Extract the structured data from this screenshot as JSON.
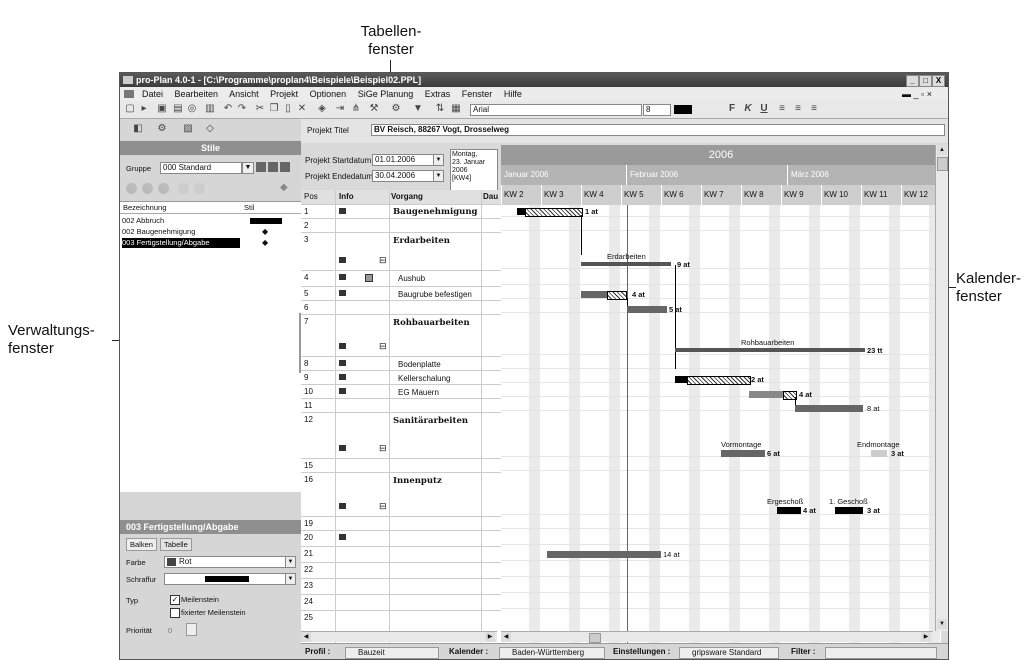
{
  "callouts": {
    "tabellen": "Tabellen-\nfenster",
    "kalender": "Kalender-\nfenster",
    "verwaltung": "Verwaltungs-\nfenster"
  },
  "window": {
    "title": "pro-Plan 4.0-1 - [C:\\Programme\\proplan4\\Beispiele\\Beispiel02.PPL]",
    "minimize": "_",
    "maximize": "□",
    "close": "X"
  },
  "menu": [
    "Datei",
    "Bearbeiten",
    "Ansicht",
    "Projekt",
    "Optionen",
    "SiGe Planung",
    "Extras",
    "Fenster",
    "Hilfe"
  ],
  "toolbar": {
    "font": "Arial",
    "font_size": "8",
    "bold": "F",
    "italic": "K",
    "underline": "U"
  },
  "left": {
    "styles_header": "Stile",
    "group_label": "Gruppe",
    "group_value": "000 Standard",
    "col_name": "Bezeichnung",
    "col_style": "Stil",
    "styles": [
      "002 Abbruch",
      "002 Baugenehmigung",
      "003 Fertigstellung/Abgabe"
    ],
    "detail_header": "003 Fertigstellung/Abgabe",
    "tabs": [
      "Balken",
      "Tabelle"
    ],
    "farbe_label": "Farbe",
    "farbe_value": "Rot",
    "schraffur_label": "Schraffur",
    "typ_label": "Typ",
    "meilenstein": "Meilenstein",
    "fix_meilenstein": "fixierter Meilenstein",
    "prio_label": "Priorität",
    "prio_value": "0"
  },
  "project": {
    "title_label": "Projekt Titel",
    "title_value": "BV Reisch, 88267 Vogt, Drosselweg",
    "start_label": "Projekt Startdatum",
    "start_value": "01.01.2006",
    "end_label": "Projekt Endedatum",
    "end_value": "30.04.2006",
    "today": "Montag,\n23. Januar\n2006\n[KW4]"
  },
  "table": {
    "col_pos": "Pos",
    "col_info": "Info",
    "col_vorgang": "Vorgang",
    "col_dau": "Dau",
    "rows": [
      {
        "pos": "1",
        "name": "Baugenehmigung",
        "bold": true
      },
      {
        "pos": "2",
        "name": ""
      },
      {
        "pos": "3",
        "name": "Erdarbeiten",
        "bold": true
      },
      {
        "pos": "4",
        "name": "Aushub"
      },
      {
        "pos": "5",
        "name": "Baugrube befestigen"
      },
      {
        "pos": "6",
        "name": ""
      },
      {
        "pos": "7",
        "name": "Rohbauarbeiten",
        "bold": true
      },
      {
        "pos": "8",
        "name": "Bodenplatte"
      },
      {
        "pos": "9",
        "name": "Kellerschalung"
      },
      {
        "pos": "10",
        "name": "EG Mauern"
      },
      {
        "pos": "11",
        "name": ""
      },
      {
        "pos": "12",
        "name": "Sanitärarbeiten",
        "bold": true
      },
      {
        "pos": "15",
        "name": ""
      },
      {
        "pos": "16",
        "name": "Innenputz",
        "bold": true
      },
      {
        "pos": "19",
        "name": ""
      },
      {
        "pos": "20",
        "name": ""
      },
      {
        "pos": "21",
        "name": ""
      },
      {
        "pos": "22",
        "name": ""
      },
      {
        "pos": "23",
        "name": ""
      },
      {
        "pos": "24",
        "name": ""
      },
      {
        "pos": "25",
        "name": ""
      }
    ]
  },
  "calendar": {
    "year": "2006",
    "months": [
      "Januar 2006",
      "Februar 2006",
      "März 2006"
    ],
    "weeks": [
      "KW 2",
      "KW 3",
      "KW 4",
      "KW 5",
      "KW 6",
      "KW 7",
      "KW 8",
      "KW 9",
      "KW 10",
      "KW 11",
      "KW 12"
    ],
    "labels": {
      "erdarbeiten": "Erdarbeiten",
      "rohbau": "Rohbauarbeiten",
      "vormontage": "Vormontage",
      "endmontage": "Endmontage",
      "ergeschoss": "Ergeschoß",
      "geschoss1": "1. Geschoß"
    },
    "durations": {
      "baugenehmigung": "1 at",
      "erdarbeiten": "9 at",
      "aushub": "4 at",
      "baugrube": "5 at",
      "rohbau": "23 tt",
      "bodenplatte": "2 at",
      "keller": "4 at",
      "eg": "8 at",
      "vormontage": "6 at",
      "endmontage": "3 at",
      "ergeschoss": "4 at",
      "geschoss1": "3 at",
      "row20": "14 at"
    }
  },
  "status": {
    "profil_label": "Profil :",
    "profil_value": "Bauzeit",
    "kalender_label": "Kalender :",
    "kalender_value": "Baden-Württemberg",
    "einst_label": "Einstellungen :",
    "einst_value": "gripsware Standard",
    "filter_label": "Filter :"
  }
}
